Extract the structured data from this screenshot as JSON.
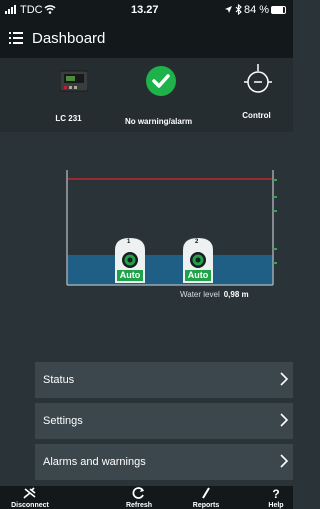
{
  "status_bar": {
    "carrier": "TDC",
    "time": "13.27",
    "battery": "84 %",
    "battery_level": 0.84
  },
  "nav": {
    "title": "Dashboard"
  },
  "tiles": [
    {
      "label": "LC 231",
      "icon": "controller-device-icon"
    },
    {
      "label": "No warning/alarm",
      "icon": "checkmark-circle-icon",
      "color": "#1fb24a"
    },
    {
      "label": "Control",
      "icon": "control-dial-icon"
    }
  ],
  "tank": {
    "pumps": [
      {
        "number": "1",
        "mode": "Auto"
      },
      {
        "number": "2",
        "mode": "Auto"
      }
    ],
    "water_level_label": "Water level",
    "water_level_value": "0,98 m",
    "alarm_line_color": "#c0272d",
    "water_color": "#1f5f86",
    "auto_color": "#1fa24a"
  },
  "menu": [
    {
      "label": "Status"
    },
    {
      "label": "Settings"
    },
    {
      "label": "Alarms and warnings"
    }
  ],
  "tabs": [
    {
      "label": "Disconnect",
      "icon": "disconnect-icon"
    },
    {
      "label": "Refresh",
      "icon": "refresh-icon"
    },
    {
      "label": "Reports",
      "icon": "reports-icon"
    },
    {
      "label": "Help",
      "icon": "help-icon"
    }
  ]
}
